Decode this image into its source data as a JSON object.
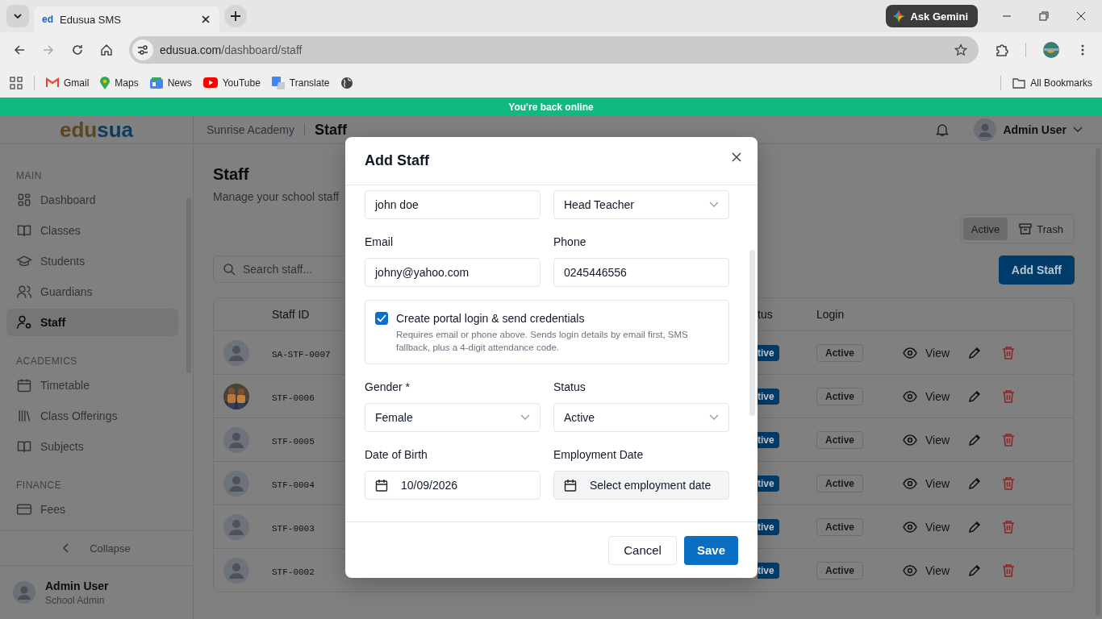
{
  "browser": {
    "tabs": [
      {
        "favicon": "ed",
        "title": "Edusua SMS"
      }
    ],
    "ask_button": "Ask Gemini",
    "url": {
      "host": "edusua.com",
      "path": "/dashboard/staff"
    },
    "bookmarks": [
      {
        "label": "Gmail"
      },
      {
        "label": "Maps"
      },
      {
        "label": "News"
      },
      {
        "label": "YouTube"
      },
      {
        "label": "Translate"
      }
    ],
    "all_bookmarks": "All Bookmarks"
  },
  "banner": "You're back online",
  "header": {
    "logo_first": "edu",
    "logo_second": "sua",
    "school": "Sunrise Academy",
    "page": "Staff",
    "user": "Admin User"
  },
  "sidebar": {
    "sections": [
      {
        "title": "MAIN",
        "items": [
          {
            "label": "Dashboard",
            "selected": false
          },
          {
            "label": "Classes",
            "selected": false
          },
          {
            "label": "Students",
            "selected": false
          },
          {
            "label": "Guardians",
            "selected": false
          },
          {
            "label": "Staff",
            "selected": true
          }
        ]
      },
      {
        "title": "ACADEMICS",
        "items": [
          {
            "label": "Timetable",
            "selected": false
          },
          {
            "label": "Class Offerings",
            "selected": false
          },
          {
            "label": "Subjects",
            "selected": false
          }
        ]
      },
      {
        "title": "FINANCE",
        "items": [
          {
            "label": "Fees",
            "selected": false
          }
        ]
      }
    ],
    "collapse": "Collapse",
    "user": {
      "name": "Admin User",
      "role": "School Admin"
    }
  },
  "page": {
    "title": "Staff",
    "subtitle": "Manage your school staff",
    "view_toggle": [
      {
        "label": "Active",
        "selected": true
      },
      {
        "label": "Trash",
        "selected": false
      }
    ],
    "search": {
      "placeholder": "Search staff..."
    },
    "add_button": "Add Staff",
    "table": {
      "columns": [
        "Staff ID",
        "tus",
        "Login"
      ],
      "rows": [
        {
          "kind": "placeholder",
          "staff_id": "SA-STF-0007",
          "status": "tive",
          "login": "Active",
          "view": "View"
        },
        {
          "staff_id": "STF-0006",
          "status": "tive",
          "login": "Active",
          "view": "View"
        },
        {
          "kind": "placeholder",
          "staff_id": "STF-0005",
          "status": "tive",
          "login": "Active",
          "view": "View"
        },
        {
          "kind": "placeholder",
          "staff_id": "STF-0004",
          "status": "tive",
          "login": "Active",
          "view": "View"
        },
        {
          "kind": "placeholder",
          "staff_id": "STF-0003",
          "status": "tive",
          "login": "Active",
          "view": "View"
        },
        {
          "kind": "placeholder",
          "staff_id": "STF-0002",
          "status": "tive",
          "login": "Active",
          "view": "View"
        }
      ]
    }
  },
  "modal": {
    "title": "Add Staff",
    "rows": [
      [
        {
          "kind": "text",
          "value": "john doe"
        },
        {
          "kind": "select",
          "value": "Head Teacher"
        }
      ],
      [
        {
          "kind": "text",
          "label": "Email",
          "value": "johny@yahoo.com"
        },
        {
          "kind": "text",
          "label": "Phone",
          "value": "0245446556"
        }
      ],
      [
        {
          "kind": "select",
          "label": "Gender *",
          "value": "Female"
        },
        {
          "kind": "select",
          "label": "Status",
          "value": "Active"
        }
      ],
      [
        {
          "kind": "date",
          "label": "Date of Birth",
          "value": "10/09/2026"
        },
        {
          "kind": "date",
          "label": "Employment Date",
          "placeholder": "Select employment date"
        }
      ]
    ],
    "portal_login": {
      "checked": true,
      "title": "Create portal login & send credentials",
      "description": "Requires email or phone above. Sends login details by email first, SMS fallback, plus a 4-digit attendance code."
    },
    "cancel": "Cancel",
    "save": "Save"
  }
}
